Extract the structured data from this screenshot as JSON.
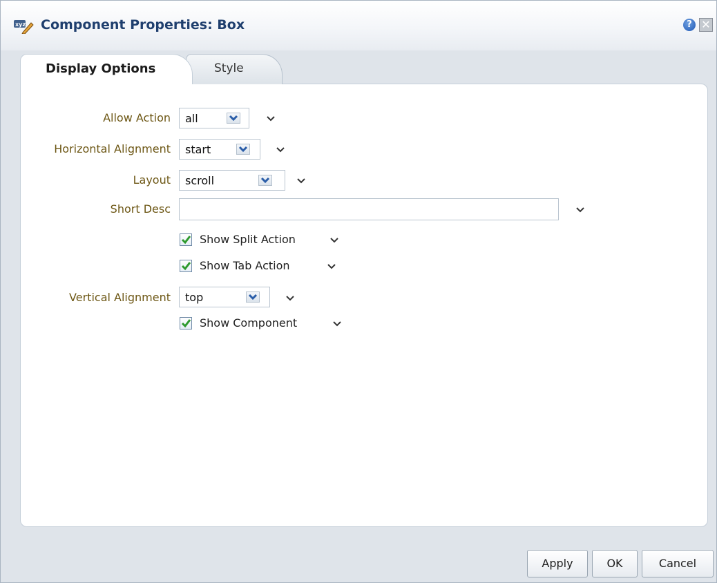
{
  "dialog": {
    "title": "Component Properties: Box",
    "title_icon": "edit-properties-icon",
    "help_icon": "help-icon",
    "close_icon": "close-icon"
  },
  "tabs": [
    {
      "label": "Display Options",
      "selected": true
    },
    {
      "label": "Style",
      "selected": false
    }
  ],
  "form": {
    "allow_action": {
      "label": "Allow Action",
      "value": "all"
    },
    "horizontal_alignment": {
      "label": "Horizontal Alignment",
      "value": "start"
    },
    "layout": {
      "label": "Layout",
      "value": "scroll"
    },
    "short_desc": {
      "label": "Short Desc",
      "value": ""
    },
    "show_split_action": {
      "label": "Show Split Action",
      "checked": true
    },
    "show_tab_action": {
      "label": "Show Tab Action",
      "checked": true
    },
    "vertical_alignment": {
      "label": "Vertical Alignment",
      "value": "top"
    },
    "show_component": {
      "label": "Show Component",
      "checked": true
    }
  },
  "footer": {
    "apply": "Apply",
    "ok": "OK",
    "cancel": "Cancel"
  },
  "colors": {
    "label_text": "#6d5715",
    "title_text": "#1f3f6e",
    "checkmark": "#2e9a2e",
    "dropdown_arrow": "#2a5da8"
  }
}
